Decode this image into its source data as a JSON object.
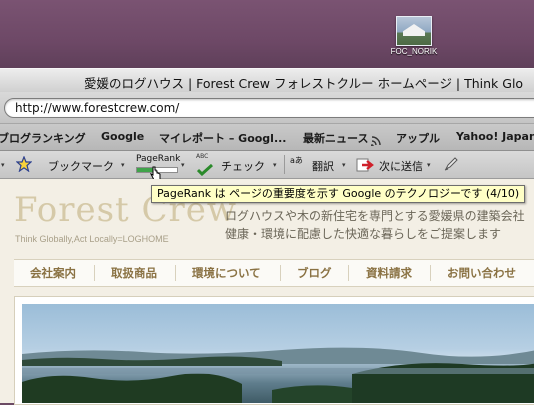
{
  "desktop": {
    "icon_label": "FOC_NORIK"
  },
  "window": {
    "title": "愛媛のログハウス | Forest Crew フォレストクルー ホームページ | Think Glo"
  },
  "navbar": {
    "url": "http://www.forestcrew.com/"
  },
  "bookmarks": [
    "ブログランキング",
    "Google",
    "マイレポート – Googl...",
    "最新ニュース",
    "アップル",
    "Yahoo! Japan"
  ],
  "google_toolbar": {
    "bookmarks_label": "ブックマーク",
    "pagerank_label": "PageRank",
    "check_label": "チェック",
    "translate_label": "翻訳",
    "send_label": "次に送信",
    "spell_icon_text": "ABC",
    "translate_icon_text": "aあ"
  },
  "tooltip": {
    "text": "PageRank は ページの重要度を示す Google のテクノロジーです (4/10)"
  },
  "pagerank": {
    "value": 0.4
  },
  "site": {
    "logo": "Forest Crew",
    "tagline": "Think Globally,Act Locally=LOGHOME",
    "intro_line1": "ログハウスや木の新住宅を専門とする愛媛県の建築会社",
    "intro_line2": "健康・環境に配慮した快適な暮らしをご提案します",
    "menu": [
      "会社案内",
      "取扱商品",
      "環境について",
      "ブログ",
      "資料請求",
      "お問い合わせ"
    ]
  },
  "colors": {
    "desktop": "#6d4866",
    "menu_text": "#8a7243",
    "tooltip_bg": "#ffffc6",
    "pagerank_fill": "#3fa34a"
  }
}
